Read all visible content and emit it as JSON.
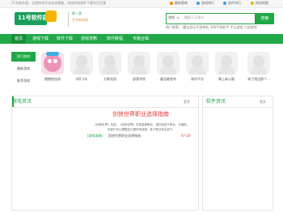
{
  "topbar": {
    "tagline": "11号软件园，让您的欢乐永远伴随着，本站所有软件下载均为正版",
    "links": [
      "最新更新",
      "游戏排行",
      "软件排行",
      "网站地图"
    ]
  },
  "header": {
    "logo_text": "11号软件园",
    "slogan_line1": "第一游",
    "slogan_line2": "生活有奇迹"
  },
  "search": {
    "category": "游戏",
    "placeholder": "搜索人天游卡",
    "button_label": "搜索",
    "hotwords": "热门搜索：  魔法战记手游单机   360手机助手   平山游戏   二战游戏"
  },
  "nav": {
    "items": [
      "首页",
      "游戏下载",
      "软件下载",
      "游戏攻略",
      "软件教程",
      "专题合辑"
    ]
  },
  "hot_section": {
    "tabs": [
      "热门游戏",
      "最新游戏",
      "推荐游戏"
    ],
    "games": [
      "猪猪侠连线",
      "QQ飞车",
      "大象花园",
      "部落冲突",
      "屠龙破苍穹",
      "海洋平台",
      "掌上新公路",
      "海了找出那个..."
    ]
  },
  "news_panel": {
    "title": "游戏资讯",
    "more": "更多",
    "headline": "剑侠世界职业选择指南",
    "summary": "《剑侠世界》手游，《剑侠世界》手游选择职业，现在有四个职业，长期的，玩家们可以根据自己喜好来选择，各个职业特点如下。",
    "items": [
      {
        "tag": "[游戏攻略]",
        "title": "剑侠世界职业选择指南",
        "date": "07-28"
      }
    ]
  },
  "soft_panel": {
    "title": "软件资讯",
    "more": "更多"
  },
  "colors": {
    "brand_green": "#20a847",
    "headline_red": "#e03a3a"
  }
}
